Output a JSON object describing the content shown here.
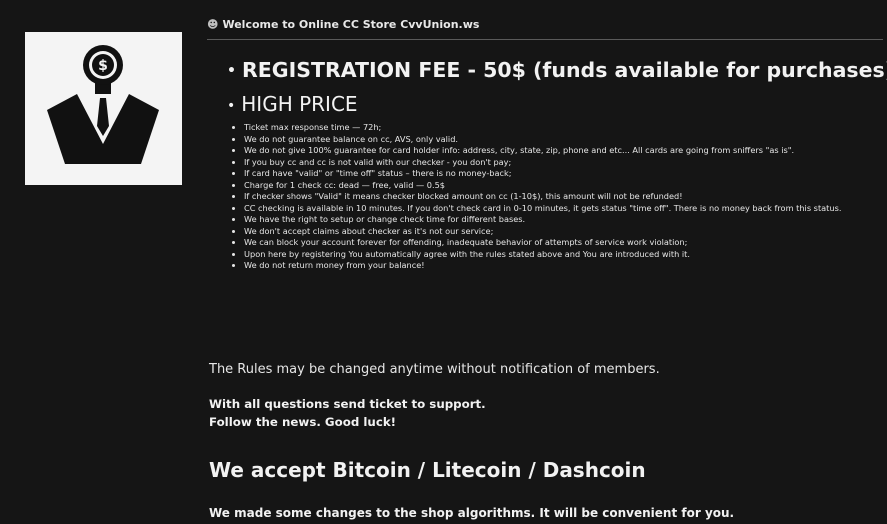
{
  "logo": {
    "icon": "suit-man-dollar-logo",
    "symbol": "$"
  },
  "header": {
    "icon": "smiley-icon",
    "title": "Welcome to Online CC Store CvvUnion.ws"
  },
  "headings": {
    "fee": "REGISTRATION FEE - 50$ (funds available for purchases)",
    "price": "HIGH PRICE",
    "payment": "We accept Bitcoin / Litecoin / Dashcoin"
  },
  "rules": [
    "Ticket max response time — 72h;",
    "We do not guarantee balance on cc, AVS, only valid.",
    "We do not give 100% guarantee for card holder info: address, city, state, zip, phone and etc... All cards are going from sniffers \"as is\".",
    "If you buy cc and cc is not valid with our checker - you don't pay;",
    "If card have \"valid\" or \"time off\" status – there is no money-back;",
    "Charge for 1 check cc: dead — free, valid — 0.5$",
    "If checker shows \"Valid\" it means checker blocked amount on cc (1-10$), this amount will not be refunded!",
    "CC checking is available in 10 minutes. If you don't check card in 0-10 minutes, it gets status \"time off\". There is no money back from this status.",
    "We have the right to setup or change check time for different bases.",
    "We don't accept claims about checker as it's not our service;",
    "We can block your account forever for offending, inadequate behavior of attempts of service work violation;",
    "Upon here by registering You automatically agree with the rules stated above and You are introduced with it.",
    "We do not return money from your balance!"
  ],
  "notes": {
    "rules_changed": "The Rules may be changed anytime without notification of members.",
    "support_line1": "With all questions send ticket to support.",
    "support_line2": "Follow the news. Good luck!",
    "changes": "We made some changes to the shop algorithms. It will be convenient for you."
  }
}
